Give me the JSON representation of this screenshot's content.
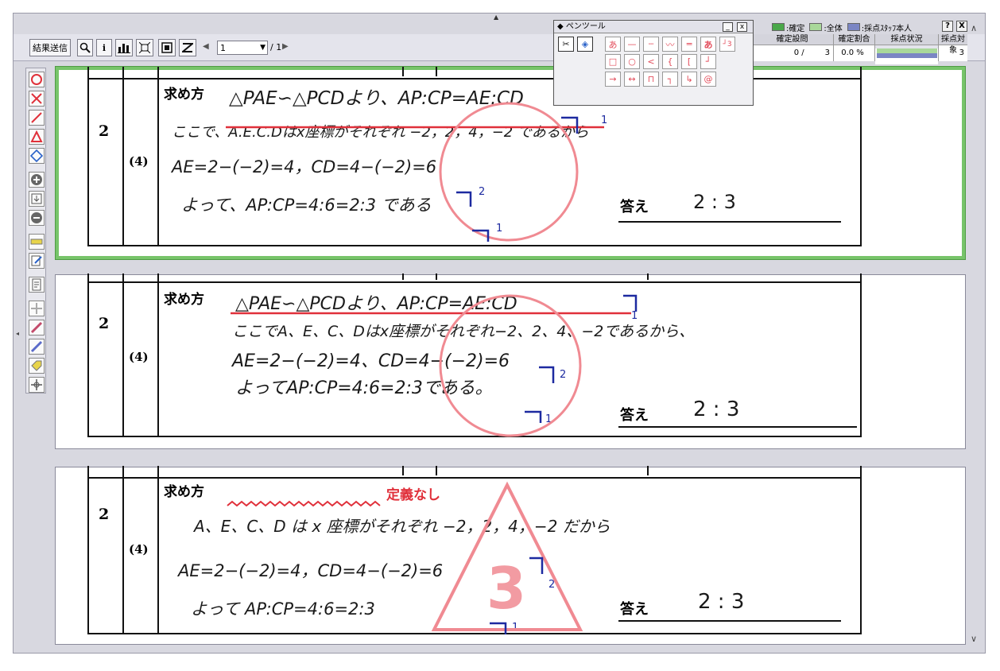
{
  "toolbar": {
    "send_label": "結果送信",
    "page_value": "1",
    "page_total": "/ 1"
  },
  "legend": {
    "confirmed": ":確定",
    "all": ":全体",
    "staff": ":採点ｽﾀｯﾌ本人",
    "help": "?",
    "close": "X",
    "colors": {
      "confirmed": "#4aa84a",
      "all": "#a9d89a",
      "staff": "#7b86c4"
    }
  },
  "stats": {
    "headers": [
      "確定設問",
      "確定割合",
      "採点状況",
      "採点対象"
    ],
    "confirmed_q": "0 /",
    "confirmed_q_total": "3",
    "ratio": "0.0 %",
    "target": "3"
  },
  "pen_palette": {
    "title": "◆ ペンツール",
    "minimize": "_",
    "close": "x",
    "row1": [
      "あ",
      "—",
      "┄",
      "〰",
      "═",
      "あ",
      "┘3"
    ],
    "row2": [
      "□",
      "○",
      "<",
      "{",
      "[",
      "┘"
    ],
    "row3": [
      "→",
      "↔",
      "⊓",
      "┐",
      "↳",
      "@"
    ]
  },
  "answers": [
    {
      "qnum": "2",
      "sub": "(4)",
      "method_label": "求め方",
      "line1": "△PAE∽△PCDより、AP:CP=AE:CD",
      "line2": "ここで、A.E.C.Dはx座標がそれぞれ −2，2，4，−2 であるから",
      "line3": "AE=2−(−2)=4，CD=4−(−2)=6",
      "line4": "よって、AP:CP=4:6=2:3 である",
      "answer_label": "答え",
      "answer_value": "2  :  3",
      "checks": [
        "1",
        "2",
        "1"
      ]
    },
    {
      "qnum": "2",
      "sub": "(4)",
      "method_label": "求め方",
      "line1": "△PAE∽△PCDより、AP:CP=AE:CD",
      "line2": "ここでA、E、C、Dはx座標がそれぞれ−2、2、4、−2であるから、",
      "line3": "AE=2−(−2)=4、CD=4−(−2)=6",
      "line4": "よってAP:CP=4:6=2:3である。",
      "answer_label": "答え",
      "answer_value": "2  :  3",
      "checks": [
        "1",
        "2",
        "1"
      ]
    },
    {
      "qnum": "2",
      "sub": "(4)",
      "method_label": "求め方",
      "red_note": "定義なし",
      "line2": "A、E、C、D は x 座標がそれぞれ −2，2，4，−2 だから",
      "line3": "AE=2−(−2)=4，CD=4−(−2)=6",
      "line4": "よって AP:CP=4:6=2:3",
      "answer_label": "答え",
      "answer_value": "2  :  3",
      "score_mark": "3",
      "checks": [
        "2",
        "1"
      ]
    }
  ]
}
